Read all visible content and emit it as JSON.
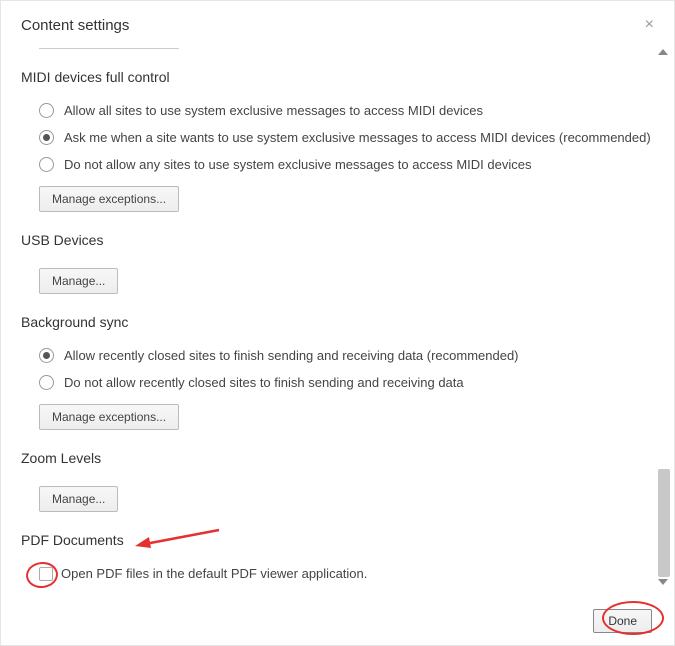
{
  "dialog": {
    "title": "Content settings",
    "close": "×"
  },
  "midi": {
    "title": "MIDI devices full control",
    "options": [
      "Allow all sites to use system exclusive messages to access MIDI devices",
      "Ask me when a site wants to use system exclusive messages to access MIDI devices (recommended)",
      "Do not allow any sites to use system exclusive messages to access MIDI devices"
    ],
    "selected": 1,
    "manage": "Manage exceptions..."
  },
  "usb": {
    "title": "USB Devices",
    "manage": "Manage..."
  },
  "bgsync": {
    "title": "Background sync",
    "options": [
      "Allow recently closed sites to finish sending and receiving data (recommended)",
      "Do not allow recently closed sites to finish sending and receiving data"
    ],
    "selected": 0,
    "manage": "Manage exceptions..."
  },
  "zoom": {
    "title": "Zoom Levels",
    "manage": "Manage..."
  },
  "pdf": {
    "title": "PDF Documents",
    "checkbox_label": "Open PDF files in the default PDF viewer application.",
    "checked": false
  },
  "footer": {
    "done": "Done"
  }
}
